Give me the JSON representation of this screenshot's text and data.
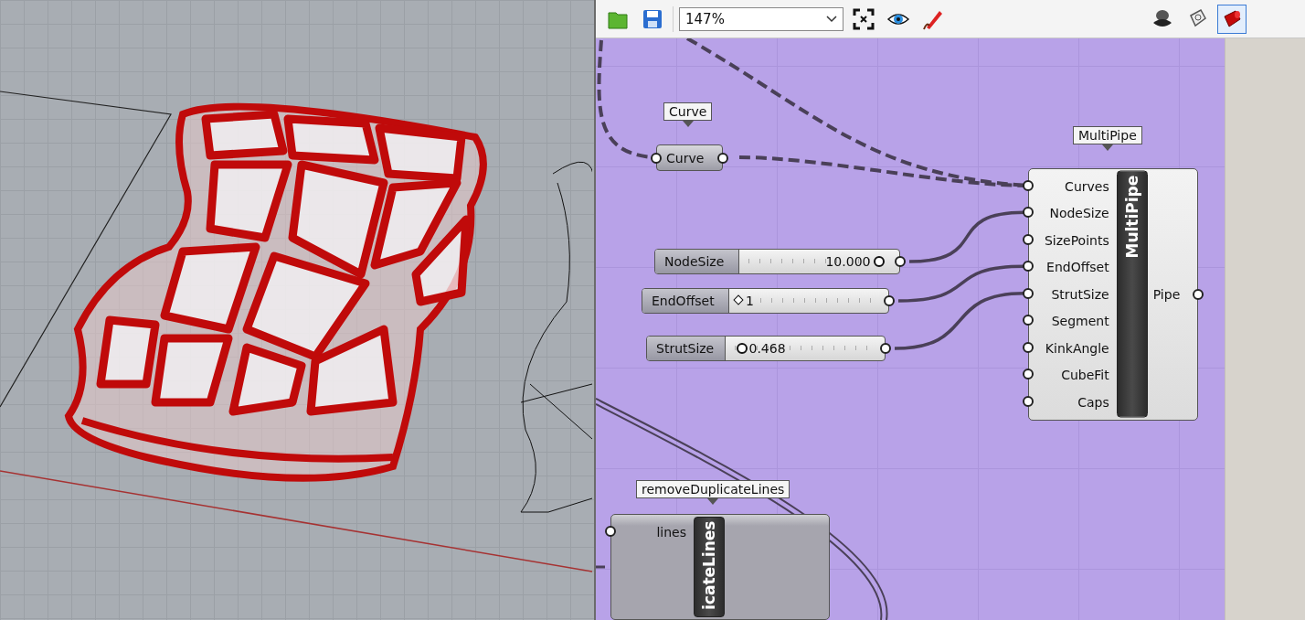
{
  "toolbar": {
    "zoom": "147%",
    "preview_modes": [
      {
        "selected": false
      },
      {
        "selected": false
      },
      {
        "selected": true
      }
    ]
  },
  "canvas": {
    "params": [
      {
        "tag": "Curve",
        "label": "Curve"
      }
    ],
    "sliders": [
      {
        "name": "NodeSize",
        "value": "10.000",
        "kind": "float",
        "level": 0.95
      },
      {
        "name": "EndOffset",
        "value": "1",
        "kind": "integer",
        "level": 0.0
      },
      {
        "name": "StrutSize",
        "value": "0.468",
        "kind": "float",
        "level": 0.05
      }
    ],
    "components": [
      {
        "tag": "MultiPipe",
        "title": "MultiPipe",
        "disabled": false,
        "inputs": [
          "Curves",
          "NodeSize",
          "SizePoints",
          "EndOffset",
          "StrutSize",
          "Segment",
          "KinkAngle",
          "CubeFit",
          "Caps"
        ],
        "outputs": [
          "Pipe"
        ]
      },
      {
        "tag": "removeDuplicateLines",
        "title": "icateLines",
        "disabled": true,
        "inputs": [
          "lines"
        ]
      }
    ]
  }
}
